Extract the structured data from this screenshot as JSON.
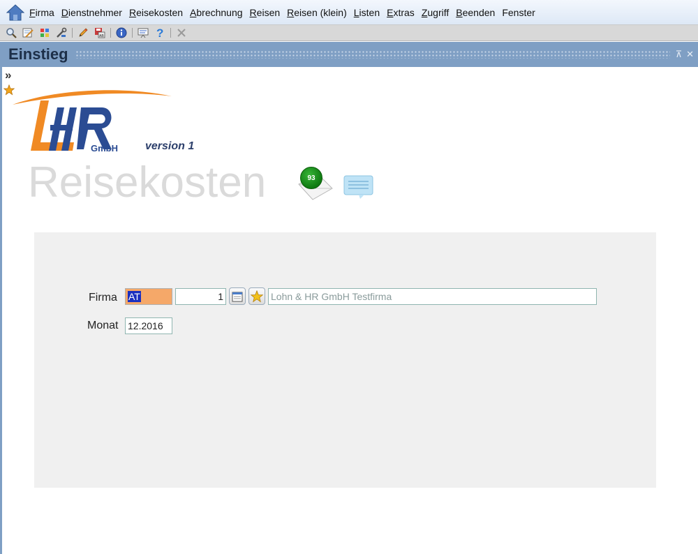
{
  "menu": {
    "items": [
      "Firma",
      "Dienstnehmer",
      "Reisekosten",
      "Abrechnung",
      "Reisen",
      "Reisen (klein)",
      "Listen",
      "Extras",
      "Zugriff",
      "Beenden",
      "Fenster"
    ]
  },
  "toolbar": {
    "icons": [
      "search-icon",
      "edit-form-icon",
      "grid-color-icon",
      "tools-icon",
      "pencil-icon",
      "save-print-icon",
      "info-icon",
      "presentation-icon",
      "help-icon",
      "close-icon"
    ]
  },
  "window": {
    "title": "Einstieg",
    "controls": [
      "pin-icon",
      "close-icon"
    ]
  },
  "logo": {
    "text": "LHR",
    "suffix": "GmbH",
    "version": "version 1"
  },
  "app_title": "Reisekosten",
  "notifications": {
    "count": "93"
  },
  "form": {
    "firma_label": "Firma",
    "firma_code": "AT",
    "firma_number": "1",
    "firma_name": "Lohn & HR GmbH Testfirma",
    "monat_label": "Monat",
    "monat_value": "12.2016"
  },
  "colors": {
    "accent": "#7f9fc4",
    "selected_field": "#f5a869",
    "panel": "#f0f0f0",
    "title_text": "#dadada"
  }
}
